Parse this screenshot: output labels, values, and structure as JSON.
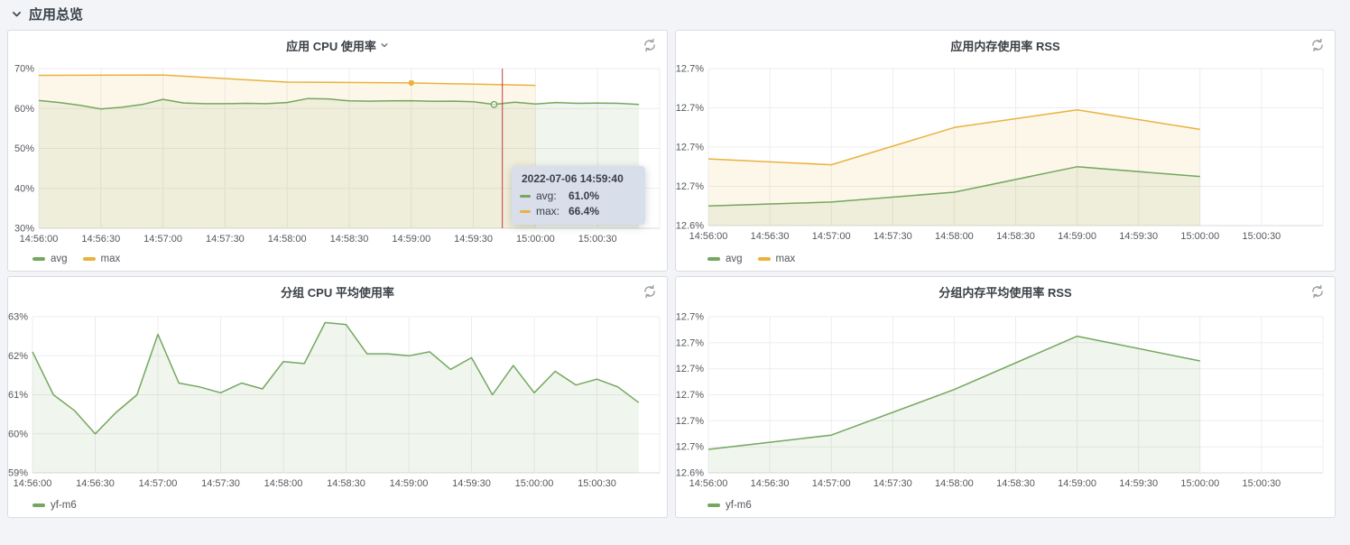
{
  "colors": {
    "green": "#74a75f",
    "orange": "#e9b23d",
    "crosshair_red": "#c43b3b",
    "tooltip_bg": "#d7ddea",
    "page_bg": "#f3f4f7",
    "panel_bg": "#ffffff",
    "panel_border": "#d9dce3"
  },
  "icons": {
    "section_collapse": "chevron-down-icon",
    "panel_refresh": "refresh-icon",
    "panel_title_caret": "chevron-down-icon"
  },
  "section": {
    "title": "应用总览"
  },
  "panels": [
    {
      "title": "应用 CPU 使用率",
      "has_title_caret": true,
      "chart_index": 0
    },
    {
      "title": "应用内存使用率 RSS",
      "has_title_caret": false,
      "chart_index": 1
    },
    {
      "title": "分组 CPU 平均使用率",
      "has_title_caret": false,
      "chart_index": 2
    },
    {
      "title": "分组内存平均使用率 RSS",
      "has_title_caret": false,
      "chart_index": 3
    }
  ],
  "chart_data": [
    {
      "type": "area",
      "title": "应用 CPU 使用率",
      "ylim": [
        30,
        70
      ],
      "y_tick_labels": [
        "70%",
        "60%",
        "50%",
        "40%",
        "30%"
      ],
      "x_step_sec": 30,
      "x_max_sec": 300,
      "x_tick_labels": [
        "14:56:00",
        "14:56:30",
        "14:57:00",
        "14:57:30",
        "14:58:00",
        "14:58:30",
        "14:59:00",
        "14:59:30",
        "15:00:00",
        "15:00:30"
      ],
      "series": [
        {
          "name": "avg",
          "color_key": "green",
          "points": [
            [
              0,
              62.0
            ],
            [
              10,
              61.5
            ],
            [
              20,
              60.8
            ],
            [
              30,
              59.9
            ],
            [
              40,
              60.3
            ],
            [
              50,
              61.0
            ],
            [
              60,
              62.3
            ],
            [
              70,
              61.4
            ],
            [
              80,
              61.2
            ],
            [
              90,
              61.2
            ],
            [
              100,
              61.3
            ],
            [
              110,
              61.2
            ],
            [
              120,
              61.5
            ],
            [
              130,
              62.5
            ],
            [
              140,
              62.4
            ],
            [
              150,
              61.9
            ],
            [
              160,
              61.85
            ],
            [
              170,
              61.9
            ],
            [
              180,
              61.95
            ],
            [
              190,
              61.8
            ],
            [
              200,
              61.85
            ],
            [
              210,
              61.7
            ],
            [
              220,
              61.0
            ],
            [
              230,
              61.6
            ],
            [
              240,
              61.15
            ],
            [
              250,
              61.5
            ],
            [
              260,
              61.3
            ],
            [
              270,
              61.35
            ],
            [
              280,
              61.3
            ],
            [
              290,
              61.0
            ]
          ]
        },
        {
          "name": "max",
          "color_key": "orange",
          "points": [
            [
              0,
              68.3
            ],
            [
              60,
              68.4
            ],
            [
              120,
              66.6
            ],
            [
              180,
              66.4
            ],
            [
              240,
              65.8
            ]
          ]
        }
      ],
      "crosshair_sec": 224,
      "highlight_dots": [
        {
          "color_key": "orange",
          "sec": 180,
          "value": 66.4,
          "style": "filled"
        },
        {
          "color_key": "green",
          "sec": 220,
          "value": 61.0,
          "style": "hollow"
        }
      ],
      "tooltip": {
        "time": "2022-07-06 14:59:40",
        "rows": [
          {
            "color_key": "green",
            "label": "avg:",
            "value": "61.0%"
          },
          {
            "color_key": "orange",
            "label": "max:",
            "value": "66.4%"
          }
        ]
      }
    },
    {
      "type": "area",
      "title": "应用内存使用率 RSS",
      "ylim": [
        12.64,
        12.72
      ],
      "y_tick_labels": [
        "12.7%",
        "12.7%",
        "12.7%",
        "12.7%",
        "12.6%"
      ],
      "x_step_sec": 30,
      "x_max_sec": 300,
      "x_tick_labels": [
        "14:56:00",
        "14:56:30",
        "14:57:00",
        "14:57:30",
        "14:58:00",
        "14:58:30",
        "14:59:00",
        "14:59:30",
        "15:00:00",
        "15:00:30"
      ],
      "series": [
        {
          "name": "avg",
          "color_key": "green",
          "points": [
            [
              0,
              12.65
            ],
            [
              60,
              12.652
            ],
            [
              120,
              12.657
            ],
            [
              180,
              12.67
            ],
            [
              240,
              12.665
            ]
          ]
        },
        {
          "name": "max",
          "color_key": "orange",
          "points": [
            [
              0,
              12.674
            ],
            [
              60,
              12.671
            ],
            [
              120,
              12.69
            ],
            [
              180,
              12.699
            ],
            [
              240,
              12.689
            ]
          ]
        }
      ]
    },
    {
      "type": "area",
      "title": "分组 CPU 平均使用率",
      "ylim": [
        59,
        63
      ],
      "y_tick_labels": [
        "63%",
        "62%",
        "61%",
        "60%",
        "59%"
      ],
      "x_step_sec": 30,
      "x_max_sec": 300,
      "x_tick_labels": [
        "14:56:00",
        "14:56:30",
        "14:57:00",
        "14:57:30",
        "14:58:00",
        "14:58:30",
        "14:59:00",
        "14:59:30",
        "15:00:00",
        "15:00:30"
      ],
      "series": [
        {
          "name": "yf-m6",
          "color_key": "green",
          "points": [
            [
              0,
              62.1
            ],
            [
              10,
              61.0
            ],
            [
              20,
              60.6
            ],
            [
              30,
              60.0
            ],
            [
              40,
              60.55
            ],
            [
              50,
              61.0
            ],
            [
              60,
              62.55
            ],
            [
              70,
              61.3
            ],
            [
              80,
              61.2
            ],
            [
              90,
              61.05
            ],
            [
              100,
              61.3
            ],
            [
              110,
              61.15
            ],
            [
              120,
              61.85
            ],
            [
              130,
              61.8
            ],
            [
              140,
              62.85
            ],
            [
              150,
              62.8
            ],
            [
              160,
              62.05
            ],
            [
              170,
              62.05
            ],
            [
              180,
              62.0
            ],
            [
              190,
              62.1
            ],
            [
              200,
              61.65
            ],
            [
              210,
              61.95
            ],
            [
              220,
              61.0
            ],
            [
              230,
              61.75
            ],
            [
              240,
              61.05
            ],
            [
              250,
              61.6
            ],
            [
              260,
              61.25
            ],
            [
              270,
              61.4
            ],
            [
              280,
              61.2
            ],
            [
              290,
              60.8
            ]
          ]
        }
      ]
    },
    {
      "type": "area",
      "title": "分组内存平均使用率 RSS",
      "ylim": [
        12.62,
        12.74
      ],
      "y_tick_labels": [
        "12.7%",
        "12.7%",
        "12.7%",
        "12.7%",
        "12.7%",
        "12.7%",
        "12.6%"
      ],
      "x_step_sec": 30,
      "x_max_sec": 300,
      "x_tick_labels": [
        "14:56:00",
        "14:56:30",
        "14:57:00",
        "14:57:30",
        "14:58:00",
        "14:58:30",
        "14:59:00",
        "14:59:30",
        "15:00:00",
        "15:00:30"
      ],
      "series": [
        {
          "name": "yf-m6",
          "color_key": "green",
          "points": [
            [
              0,
              12.638
            ],
            [
              60,
              12.649
            ],
            [
              120,
              12.684
            ],
            [
              180,
              12.725
            ],
            [
              240,
              12.706
            ]
          ]
        }
      ]
    }
  ]
}
